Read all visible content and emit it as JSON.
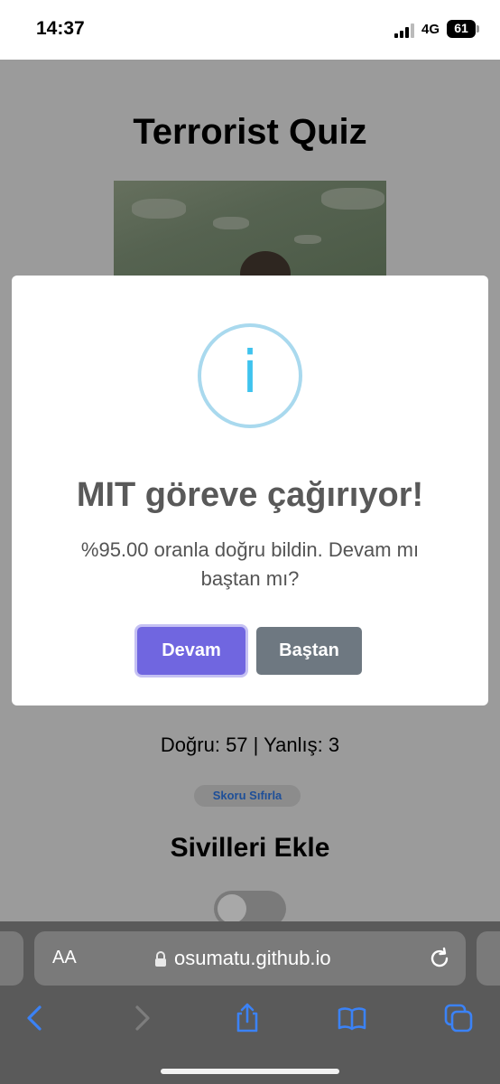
{
  "status_bar": {
    "time": "14:37",
    "network": "4G",
    "battery": "61",
    "battery_level": 0.61
  },
  "page": {
    "title": "Terrorist Quiz",
    "score_text": "Doğru: 57 | Yanlış: 3",
    "reset_label": "Skoru Sıfırla",
    "section_title": "Sivilleri Ekle",
    "toggle_on": false
  },
  "modal": {
    "icon": "info-icon",
    "icon_glyph": "i",
    "title": "MIT göreve çağırıyor!",
    "text": "%95.00 oranla doğru bildin. Devam mı baştan mı?",
    "confirm_label": "Devam",
    "deny_label": "Baştan"
  },
  "browser": {
    "text_size_label": "AA",
    "url": "osumatu.github.io",
    "toolbar_icons": [
      "back-icon",
      "forward-icon",
      "share-icon",
      "bookmarks-icon",
      "tabs-icon"
    ]
  },
  "colors": {
    "confirm": "#7066e0",
    "deny": "#6e7881",
    "info": "#3fc3ee",
    "toolbar_icon": "#3b82f6"
  }
}
